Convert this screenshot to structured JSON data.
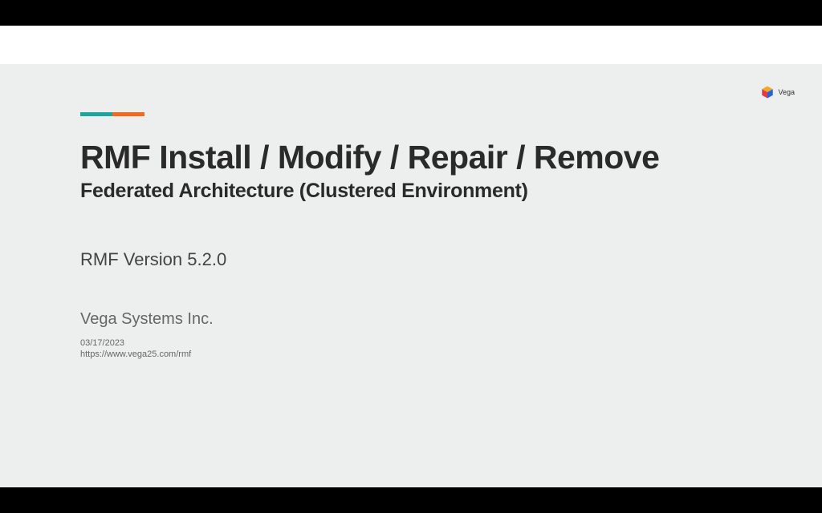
{
  "slide": {
    "title": "RMF Install / Modify / Repair / Remove",
    "subtitle": "Federated Architecture (Clustered Environment)",
    "version": "RMF Version 5.2.0",
    "company": "Vega Systems Inc.",
    "date": "03/17/2023",
    "url": "https://www.vega25.com/rmf"
  },
  "logo": {
    "name": "Vega"
  },
  "colors": {
    "accent_teal": "#1aa69f",
    "accent_orange": "#f26b1c",
    "slide_bg": "#ecefee"
  }
}
